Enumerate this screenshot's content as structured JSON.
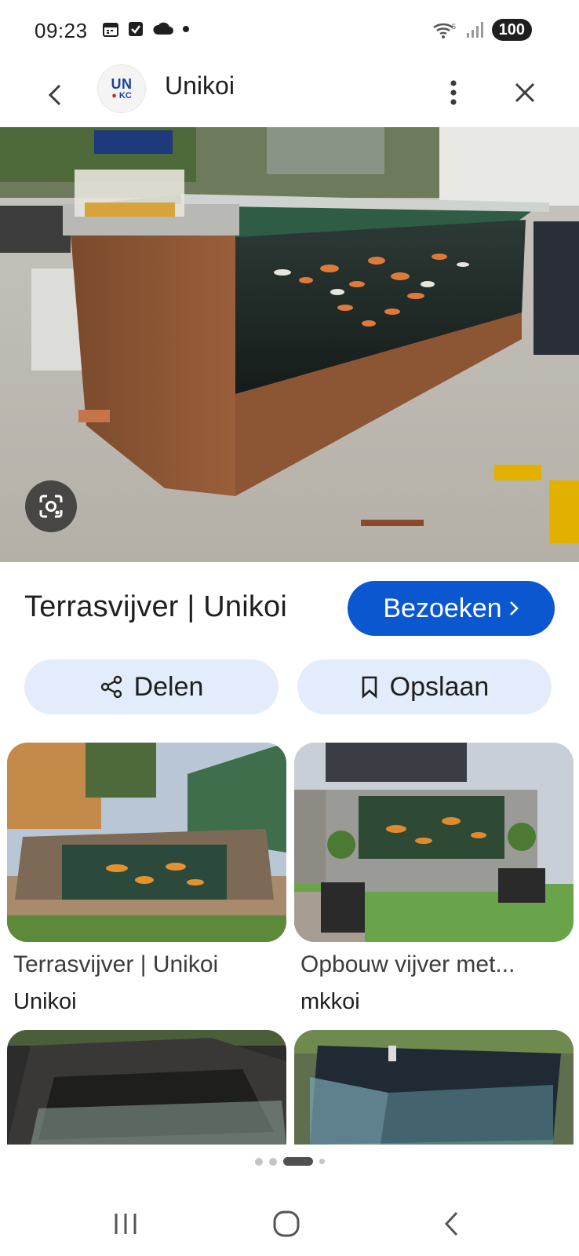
{
  "status_bar": {
    "time": "09:23",
    "battery": "100",
    "icons_left": [
      "calendar-icon",
      "check-square-icon",
      "cloud-icon",
      "dot-icon"
    ],
    "icons_right": [
      "wifi-icon",
      "signal-icon"
    ]
  },
  "header": {
    "logo_line1": "UN",
    "logo_line2": "KC",
    "site_name": "Unikoi"
  },
  "result": {
    "title": "Terrasvijver | Unikoi",
    "visit_label": "Bezoeken",
    "share_label": "Delen",
    "save_label": "Opslaan"
  },
  "related": [
    {
      "title": "Terrasvijver | Unikoi",
      "source": "Unikoi"
    },
    {
      "title": "Opbouw vijver met...",
      "source": "mkkoi"
    },
    {
      "title": "",
      "source": ""
    },
    {
      "title": "",
      "source": ""
    }
  ],
  "pagination": {
    "count": 4,
    "active_index": 2
  },
  "colors": {
    "accent": "#0b57d0",
    "chip_background": "#e3ecfa",
    "text": "#1f1f1f"
  }
}
